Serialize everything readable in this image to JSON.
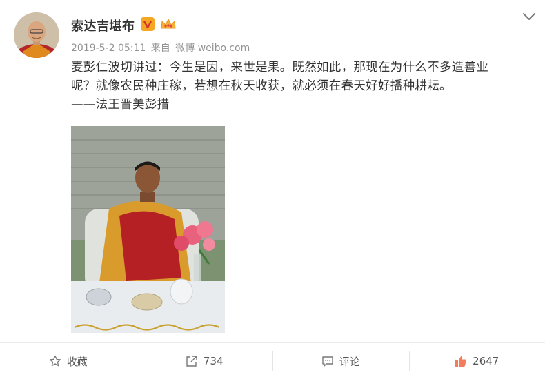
{
  "post": {
    "author": {
      "name": "索达吉堪布",
      "verified_badge": "V",
      "avatar_icon": "monk-portrait"
    },
    "meta": {
      "timestamp": "2019-5-2 05:11",
      "source_prefix": "来自",
      "source_name": "微博 weibo.com"
    },
    "content": {
      "line1": "麦彭仁波切讲过：今生是因，来世是果。既然如此，那现在为什么不多造善业",
      "line2": "呢？就像农民种庄稼，若想在秋天收获，就必须在春天好好播种耕耘。",
      "line3": "——法王晋美彭措"
    },
    "image": {
      "description_icon": "photo-of-seated-lama-with-flowers"
    },
    "actions": {
      "favorite_label": "收藏",
      "repost_count": "734",
      "comment_label": "评论",
      "like_count": "2647"
    },
    "colors": {
      "like_accent": "#f27c5c",
      "verified_orange": "#f5a623",
      "meta_gray": "#939393"
    }
  }
}
